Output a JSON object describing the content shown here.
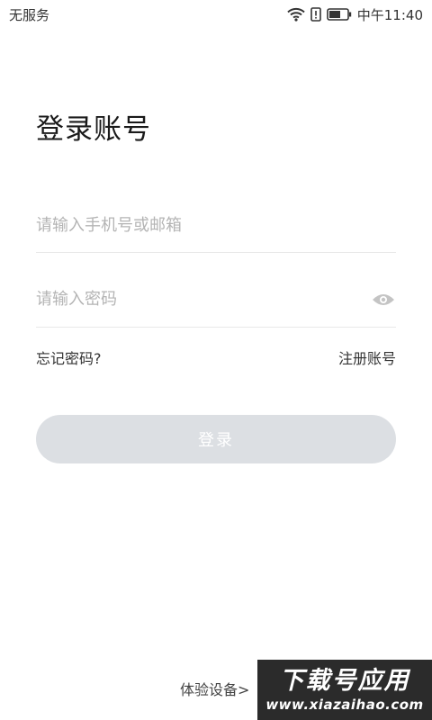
{
  "status_bar": {
    "carrier": "无服务",
    "time": "中午11:40",
    "icons": [
      "wifi-icon",
      "alert-icon",
      "battery-icon"
    ]
  },
  "login": {
    "title": "登录账号",
    "phone_placeholder": "请输入手机号或邮箱",
    "password_placeholder": "请输入密码",
    "forgot_password": "忘记密码?",
    "register": "注册账号",
    "login_button": "登录",
    "trial": "体验设备>"
  },
  "watermark": {
    "title": "下载号应用",
    "url": "www.xiazaihao.com"
  },
  "colors": {
    "button_disabled": "#dcdfe3",
    "placeholder": "#b4b4b4",
    "divider": "#e8e8e8"
  }
}
